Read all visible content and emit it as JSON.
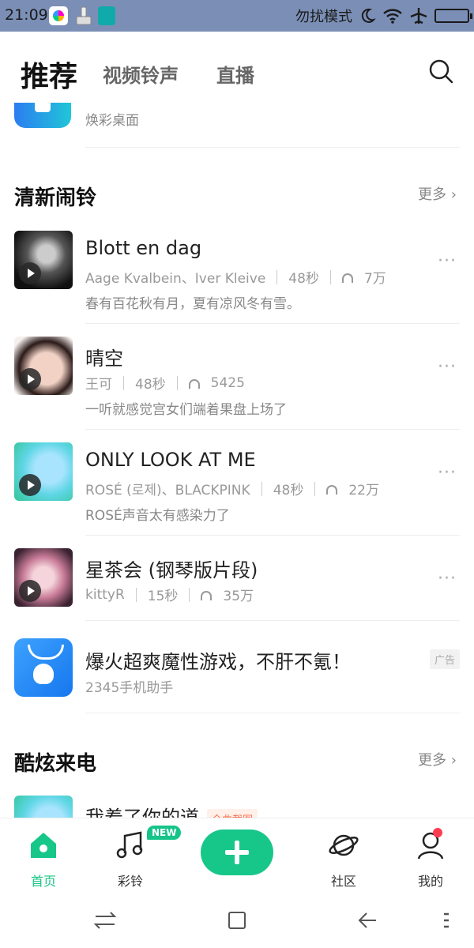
{
  "status_bar": {
    "time": "21:09",
    "dnd_text": "勿扰模式",
    "icons": [
      "app-icon",
      "brush-icon",
      "usb-icon",
      "moon-icon",
      "wifi-icon",
      "airplane-icon",
      "battery-icon"
    ]
  },
  "top_tabs": {
    "active": "推荐",
    "tabs": [
      "视频铃声",
      "直播"
    ],
    "search_icon": "search-icon"
  },
  "partial_item": {
    "label": "焕彩桌面"
  },
  "sections": [
    {
      "title": "清新闹铃",
      "more": "更多",
      "items": [
        {
          "name": "Blott en dag",
          "artist": "Aage Kvalbein、Iver Kleive",
          "duration": "48秒",
          "plays": "7万",
          "desc": "春有百花秋有月，夏有凉风冬有雪。"
        },
        {
          "name": "晴空",
          "artist": "王可",
          "duration": "48秒",
          "plays": "5425",
          "desc": "一听就感觉宫女们端着果盘上场了"
        },
        {
          "name": "ONLY LOOK AT ME",
          "artist": "ROSÉ (로제)、BLACKPINK",
          "duration": "48秒",
          "plays": "22万",
          "desc": "ROSÉ声音太有感染力了"
        },
        {
          "name": "星茶会 (钢琴版片段)",
          "artist": "kittyR",
          "duration": "15秒",
          "plays": "35万",
          "desc": ""
        }
      ]
    },
    {
      "title": "酷炫来电",
      "more": "更多",
      "items": [
        {
          "name": "我着了你的道",
          "tag": "全曲截图"
        }
      ]
    }
  ],
  "ad": {
    "title": "爆火超爽魔性游戏，不肝不氪！",
    "subtitle": "2345手机助手",
    "badge": "广告"
  },
  "bottom_nav": {
    "items": [
      {
        "label": "首页",
        "icon": "home-icon",
        "active": true
      },
      {
        "label": "彩铃",
        "icon": "music-note-icon",
        "badge": "NEW"
      },
      {
        "label": "",
        "icon": "plus-icon"
      },
      {
        "label": "社区",
        "icon": "planet-icon"
      },
      {
        "label": "我的",
        "icon": "profile-icon"
      }
    ]
  },
  "colors": {
    "accent": "#17c78a",
    "status_bar_bg": "#7b8fb6",
    "tag": "#ff6a4d",
    "notification_dot": "#ff3b50"
  }
}
